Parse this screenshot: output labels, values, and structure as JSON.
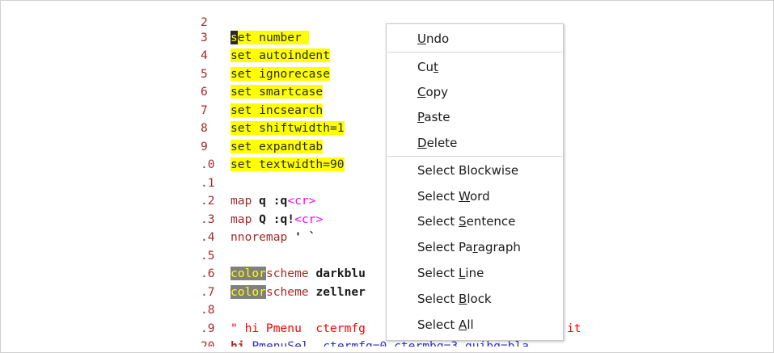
{
  "editor": {
    "lines": [
      {
        "num": "2",
        "top": 0
      },
      {
        "num": "3",
        "text_a": "s",
        "text_b": "et number"
      },
      {
        "num": "4",
        "text": "set autoindent"
      },
      {
        "num": "5",
        "text": "set ignorecase"
      },
      {
        "num": "6",
        "text": "set smartcase"
      },
      {
        "num": "7",
        "text": "set incsearch"
      },
      {
        "num": "8",
        "text": "set shiftwidth=1"
      },
      {
        "num": "9",
        "text": "set expandtab"
      },
      {
        "num": ".0",
        "text": "set textwidth=90"
      },
      {
        "num": ".1"
      },
      {
        "num": ".2",
        "kw": "map",
        "lhs": "q :q",
        "special": "<cr>"
      },
      {
        "num": ".3",
        "kw": "map",
        "lhs": "Q :q!",
        "special": "<cr>"
      },
      {
        "num": ".4",
        "kw": "nnoremap",
        "lhs": "' `"
      },
      {
        "num": ".5"
      },
      {
        "num": ".6",
        "hl": "color",
        "kw": "scheme",
        "arg": "darkblu"
      },
      {
        "num": ".7",
        "hl": "color",
        "kw": "scheme",
        "arg": "zellner"
      },
      {
        "num": ".8"
      },
      {
        "num": ".9",
        "comment": "\" hi Pmenu  ctermfg",
        "tail": "it"
      },
      {
        "num": "20",
        "hi": "hi",
        "group": "PmenuSel",
        "attrs": "  ctermfg=0 ctermbg=3 guibg=bla"
      }
    ]
  },
  "context_menu": {
    "items": [
      {
        "pre": "",
        "u": "U",
        "post": "ndo"
      },
      {
        "pre": "Cu",
        "u": "t",
        "post": ""
      },
      {
        "pre": "",
        "u": "C",
        "post": "opy"
      },
      {
        "pre": "",
        "u": "P",
        "post": "aste"
      },
      {
        "pre": "",
        "u": "D",
        "post": "elete"
      },
      {
        "pre": "Select Blockwise",
        "u": "",
        "post": ""
      },
      {
        "pre": "Select ",
        "u": "W",
        "post": "ord"
      },
      {
        "pre": "Select ",
        "u": "S",
        "post": "entence"
      },
      {
        "pre": "Select Pa",
        "u": "r",
        "post": "agraph"
      },
      {
        "pre": "Select ",
        "u": "L",
        "post": "ine"
      },
      {
        "pre": "Select ",
        "u": "B",
        "post": "lock"
      },
      {
        "pre": "Select ",
        "u": "A",
        "post": "ll"
      }
    ]
  }
}
